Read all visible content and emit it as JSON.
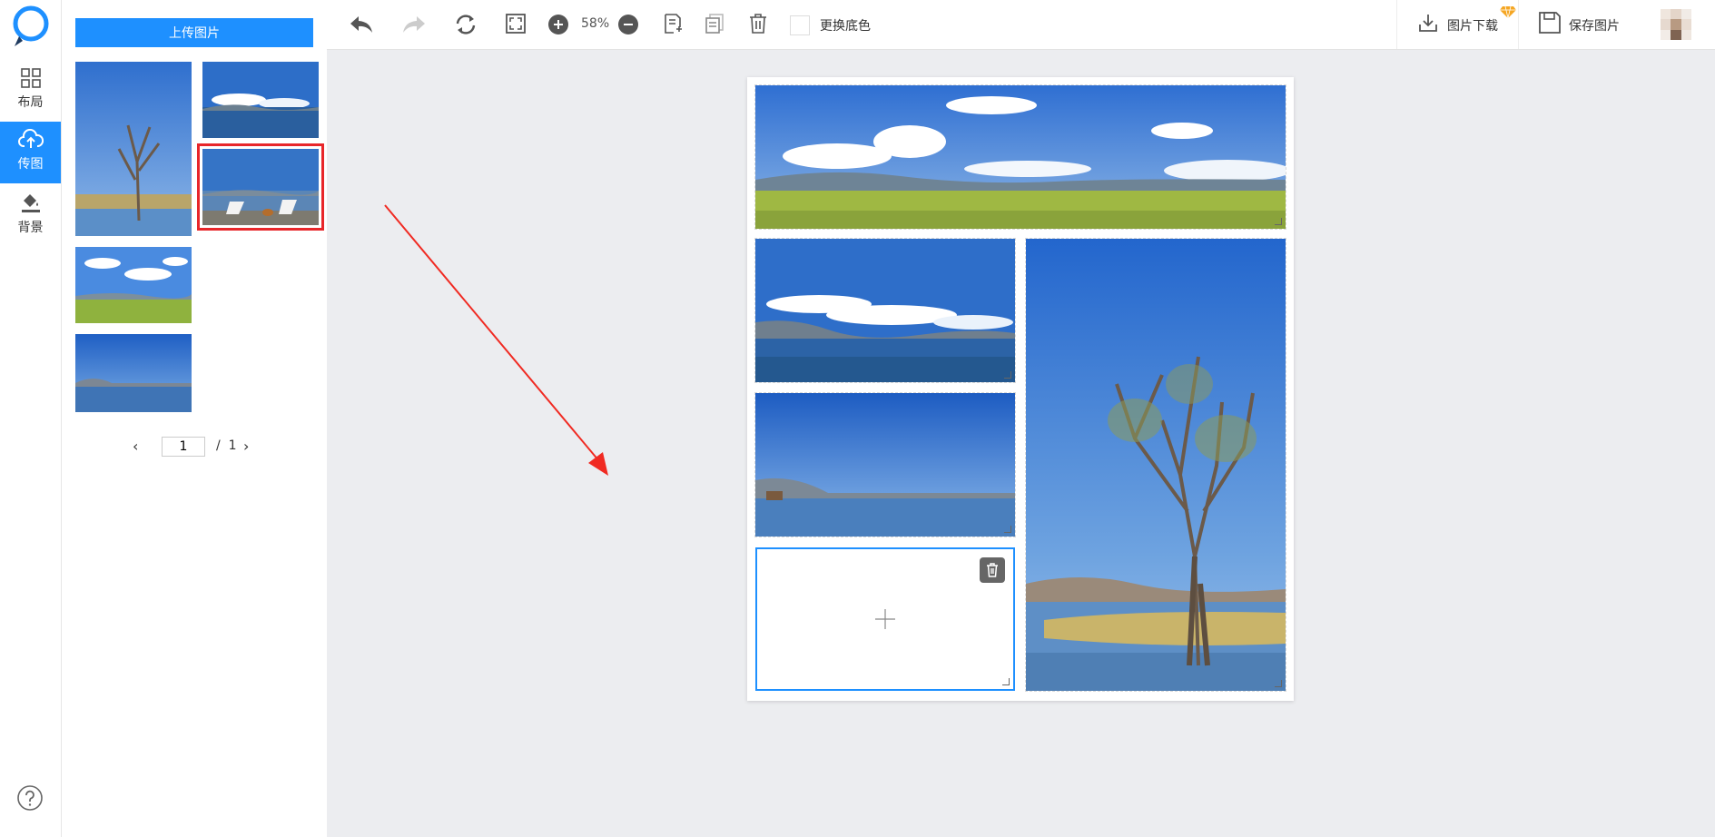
{
  "nav": {
    "items": [
      {
        "label": "布局",
        "icon": "grid-icon"
      },
      {
        "label": "传图",
        "icon": "cloud-upload-icon"
      },
      {
        "label": "背景",
        "icon": "paint-bucket-icon"
      }
    ],
    "active_index": 1
  },
  "panel": {
    "upload_label": "上传图片",
    "pagination": {
      "current": "1",
      "separator": "/",
      "total": "1",
      "prev": "‹",
      "next": "›"
    }
  },
  "toolbar": {
    "zoom": "58%",
    "change_bg_label": "更换底色",
    "download_label": "图片下载",
    "save_label": "保存图片"
  },
  "colors": {
    "accent": "#1e90ff",
    "selection": "#e8262a",
    "vip": "#f5a623",
    "workspace": "#ecedf0"
  }
}
